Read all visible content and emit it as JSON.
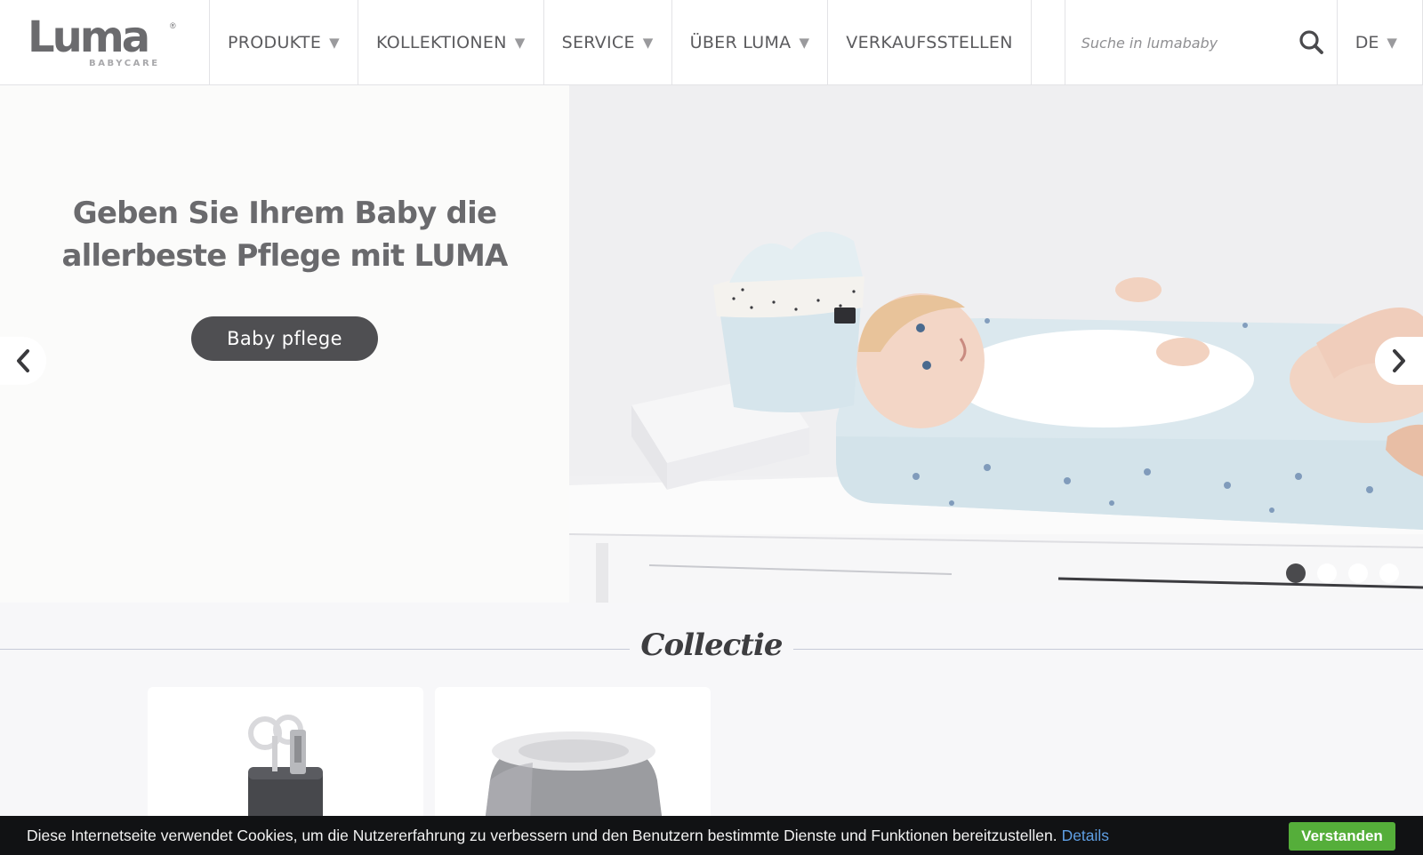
{
  "brand": {
    "logo_text": "Luma",
    "logo_subtext": "BABYCARE",
    "logo_mark": "®"
  },
  "nav": {
    "items": [
      {
        "label": "PRODUKTE",
        "has_dropdown": true
      },
      {
        "label": "KOLLEKTIONEN",
        "has_dropdown": true
      },
      {
        "label": "SERVICE",
        "has_dropdown": true
      },
      {
        "label": "ÜBER LUMA",
        "has_dropdown": true
      },
      {
        "label": "VERKAUFSSTELLEN",
        "has_dropdown": false
      }
    ],
    "dropdown_caret": "▼"
  },
  "search": {
    "placeholder": "Suche in lumababy",
    "icon": "search-icon"
  },
  "language": {
    "current": "DE",
    "caret": "▼"
  },
  "hero": {
    "title_line1": "Geben Sie Ihrem Baby die",
    "title_line2": "allerbeste Pflege mit LUMA",
    "cta_label": "Baby pflege",
    "prev_icon": "chevron-left-icon",
    "next_icon": "chevron-right-icon",
    "slide_count": 4,
    "active_slide": 1
  },
  "collection": {
    "heading": "Collectie",
    "cards": [
      {
        "product": "manicure-set"
      },
      {
        "product": "potty"
      }
    ]
  },
  "cookie_bar": {
    "message": "Diese Internetseite verwendet Cookies, um die Nutzererfahrung zu verbessern und den Benutzern bestimmte Dienste und Funktionen bereitzustellen.",
    "details_label": "Details",
    "accept_label": "Verstanden"
  },
  "colors": {
    "accent_dark": "#4f4f52",
    "text_gray": "#5b5b5e",
    "cookie_bg": "#111214",
    "cookie_link": "#5f9fe4",
    "accept_green": "#55ae3a"
  }
}
